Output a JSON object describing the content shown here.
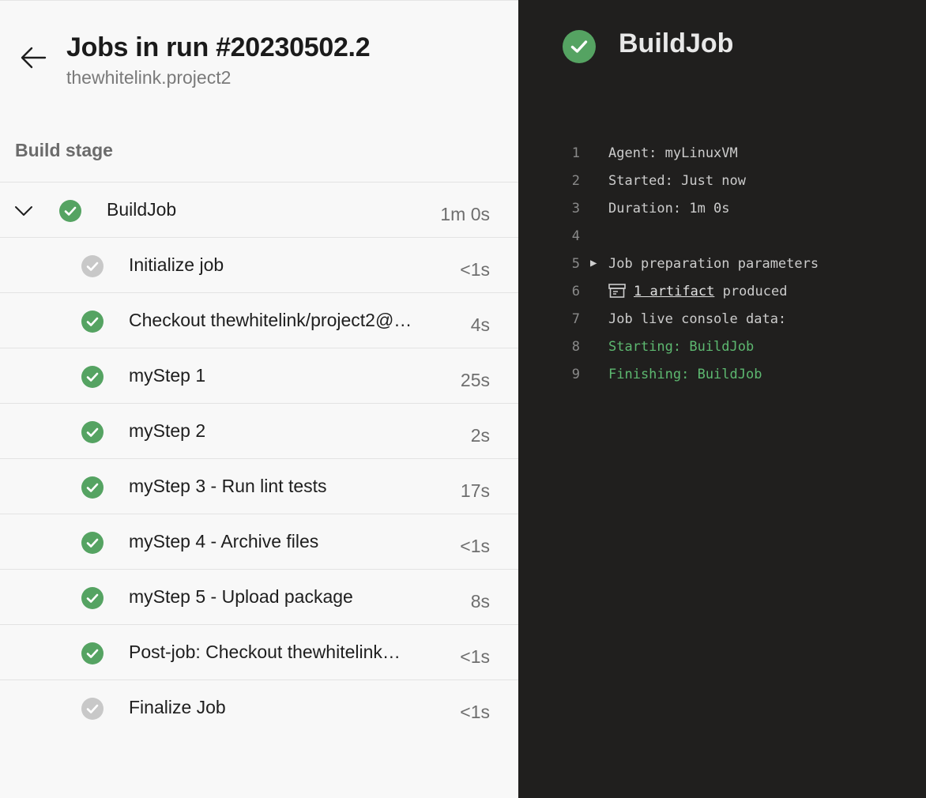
{
  "header": {
    "title": "Jobs in run #20230502.2",
    "subtitle": "thewhitelink.project2"
  },
  "stage": {
    "name": "Build stage"
  },
  "job": {
    "name": "BuildJob",
    "duration": "1m 0s",
    "status": "success"
  },
  "steps": [
    {
      "name": "Initialize job",
      "duration": "<1s",
      "status": "neutral"
    },
    {
      "name": "Checkout thewhitelink/project2@…",
      "duration": "4s",
      "status": "success"
    },
    {
      "name": "myStep 1",
      "duration": "25s",
      "status": "success"
    },
    {
      "name": "myStep 2",
      "duration": "2s",
      "status": "success"
    },
    {
      "name": "myStep 3 - Run lint tests",
      "duration": "17s",
      "status": "success"
    },
    {
      "name": "myStep 4 - Archive files",
      "duration": "<1s",
      "status": "success"
    },
    {
      "name": "myStep 5 - Upload package",
      "duration": "8s",
      "status": "success"
    },
    {
      "name": "Post-job: Checkout thewhitelink…",
      "duration": "<1s",
      "status": "success"
    },
    {
      "name": "Finalize Job",
      "duration": "<1s",
      "status": "neutral"
    }
  ],
  "detail": {
    "title": "BuildJob",
    "log": [
      {
        "num": "1",
        "text": "Agent: myLinuxVM"
      },
      {
        "num": "2",
        "text": "Started: Just now"
      },
      {
        "num": "3",
        "text": "Duration: 1m 0s"
      },
      {
        "num": "4",
        "text": ""
      },
      {
        "num": "5",
        "text": "Job preparation parameters",
        "expander": "▶"
      },
      {
        "num": "6",
        "link": "1 artifact",
        "text": " produced"
      },
      {
        "num": "7",
        "text": "Job live console data:"
      },
      {
        "num": "8",
        "text": "Starting: BuildJob",
        "color": "green"
      },
      {
        "num": "9",
        "text": "Finishing: BuildJob",
        "color": "green"
      }
    ]
  },
  "colors": {
    "success": "#55a362",
    "neutral": "#c8c8c8",
    "log_green": "#5db870",
    "panel_dark": "#201f1e",
    "panel_light": "#f8f8f8"
  }
}
